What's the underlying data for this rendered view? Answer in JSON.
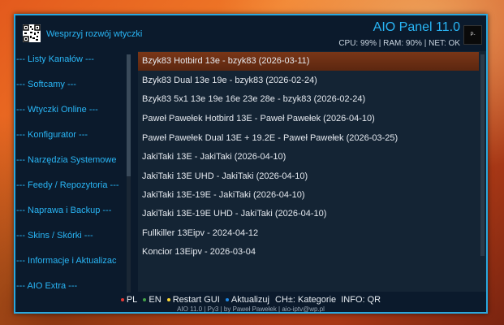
{
  "header": {
    "support_text": "Wesprzyj rozwój wtyczki",
    "app_title": "AIO Panel 11.0",
    "stats": "CPU: 99% | RAM: 90% | NET: OK",
    "logo_text": "P-"
  },
  "sidebar": {
    "items": [
      {
        "label": "--- Listy Kanałów ---"
      },
      {
        "label": "--- Softcamy ---"
      },
      {
        "label": "--- Wtyczki Online ---"
      },
      {
        "label": "--- Konfigurator ---"
      },
      {
        "label": "--- Narzędzia Systemowe"
      },
      {
        "label": "--- Feedy / Repozytoria ---"
      },
      {
        "label": "--- Naprawa i Backup ---"
      },
      {
        "label": "--- Skins / Skórki ---"
      },
      {
        "label": "--- Informacje i Aktualizac"
      },
      {
        "label": "--- AIO Extra ---"
      }
    ]
  },
  "list": {
    "selected_index": 0,
    "items": [
      {
        "label": "Bzyk83 Hotbird 13e - bzyk83 (2026-03-11)"
      },
      {
        "label": "Bzyk83 Dual 13e 19e - bzyk83 (2026-02-24)"
      },
      {
        "label": "Bzyk83 5x1 13e 19e 16e 23e 28e - bzyk83 (2026-02-24)"
      },
      {
        "label": "Paweł Pawełek Hotbird 13E - Paweł Pawełek (2026-04-10)"
      },
      {
        "label": "Paweł Pawełek Dual 13E + 19.2E - Paweł Pawełek (2026-03-25)"
      },
      {
        "label": "JakiTaki 13E - JakiTaki (2026-04-10)"
      },
      {
        "label": "JakiTaki 13E UHD - JakiTaki (2026-04-10)"
      },
      {
        "label": "JakiTaki 13E-19E - JakiTaki (2026-04-10)"
      },
      {
        "label": "JakiTaki 13E-19E UHD - JakiTaki (2026-04-10)"
      },
      {
        "label": "Fullkiller 13Eipv - 2024-04-12"
      },
      {
        "label": "Koncior 13Eipv - 2026-03-04"
      }
    ]
  },
  "footer": {
    "keys": [
      {
        "color": "#e53935",
        "label": "PL"
      },
      {
        "color": "#43a047",
        "label": "EN"
      },
      {
        "color": "#fdd835",
        "label": "Restart GUI"
      },
      {
        "color": "#1e88e5",
        "label": "Aktualizuj"
      }
    ],
    "extra_keys": "CH±: Kategorie  INFO: QR",
    "credit": "AIO 11.0 | Py3 | by Paweł Pawełek | aio-iptv@wp.pl"
  },
  "colors": {
    "accent": "#29b6f6",
    "panel_bg": "#0b1a2c",
    "selected_bg": "#7a3617"
  }
}
